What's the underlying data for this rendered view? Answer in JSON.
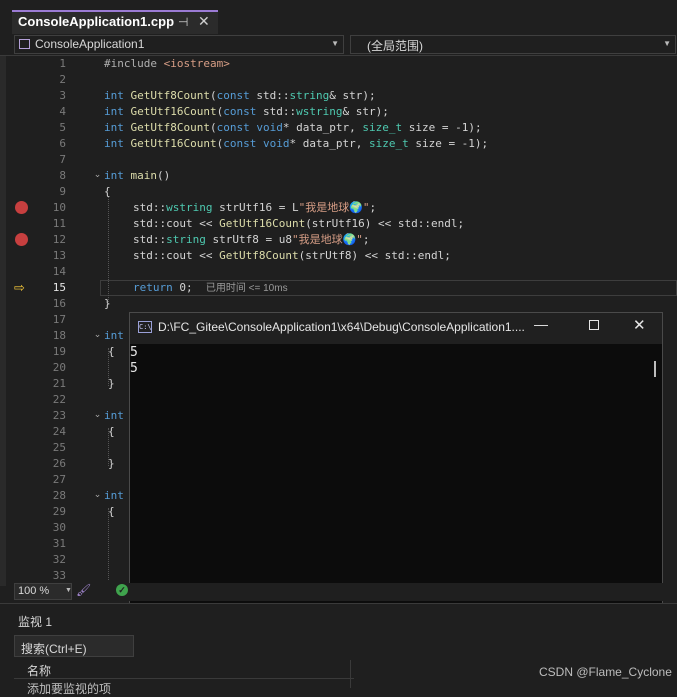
{
  "tab": {
    "title": "ConsoleApplication1.cpp",
    "pin_glyph": "⊣",
    "close_glyph": "✕"
  },
  "navbar": {
    "project": "ConsoleApplication1",
    "scope": "(全局范围)"
  },
  "lines": [
    {
      "n": "1"
    },
    {
      "n": "2"
    },
    {
      "n": "3"
    },
    {
      "n": "4"
    },
    {
      "n": "5"
    },
    {
      "n": "6"
    },
    {
      "n": "7"
    },
    {
      "n": "8"
    },
    {
      "n": "9"
    },
    {
      "n": "10"
    },
    {
      "n": "11"
    },
    {
      "n": "12"
    },
    {
      "n": "13"
    },
    {
      "n": "14"
    },
    {
      "n": "15"
    },
    {
      "n": "16"
    },
    {
      "n": "17"
    },
    {
      "n": "18"
    },
    {
      "n": "19"
    },
    {
      "n": "20"
    },
    {
      "n": "21"
    },
    {
      "n": "22"
    },
    {
      "n": "23"
    },
    {
      "n": "24"
    },
    {
      "n": "25"
    },
    {
      "n": "26"
    },
    {
      "n": "27"
    },
    {
      "n": "28"
    },
    {
      "n": "29"
    },
    {
      "n": "30"
    },
    {
      "n": "31"
    },
    {
      "n": "32"
    },
    {
      "n": "33"
    }
  ],
  "code": {
    "l1_pre": "#include ",
    "l1_inc": "<iostream>",
    "int": "int",
    "const": "const",
    "void": "void",
    "std": "std",
    "sep": "::",
    "string": "string",
    "wstring": "wstring",
    "size_t": "size_t",
    "fn_u8": "GetUtf8Count",
    "fn_u16": "GetUtf16Count",
    "main": "main",
    "l3_args": "(const std::",
    "l3_tail": "& str);",
    "l5_a": "(",
    "l5_b": "* data_ptr, ",
    "l5_c": " size = -1);",
    "open_brace": "{",
    "close_brace": "}",
    "paren_empty": "()",
    "l10_var": " strUtf16 = L",
    "l10_str": "\"我是地球🌍\"",
    "semi": ";",
    "l11_a": "std::cout << ",
    "l11_b": "(strUtf16) << std::endl;",
    "l12_var": " strUtf8 = u8",
    "l13_b": "(strUtf8) << std::endl;",
    "return": "return",
    "l15_tail": " 0;",
    "elapsed": "已用时间 <= 10ms"
  },
  "console": {
    "title": "D:\\FC_Gitee\\ConsoleApplication1\\x64\\Debug\\ConsoleApplication1....",
    "icon": "C:\\",
    "output": [
      "5",
      "5"
    ],
    "min_glyph": "—",
    "close_glyph": "✕"
  },
  "status": {
    "zoom": "100 %"
  },
  "watch": {
    "title": "监视 1",
    "search": "搜索(Ctrl+E)",
    "column_name": "名称",
    "row_hint": "添加要监视的项"
  },
  "credit": "CSDN @Flame_Cyclone"
}
